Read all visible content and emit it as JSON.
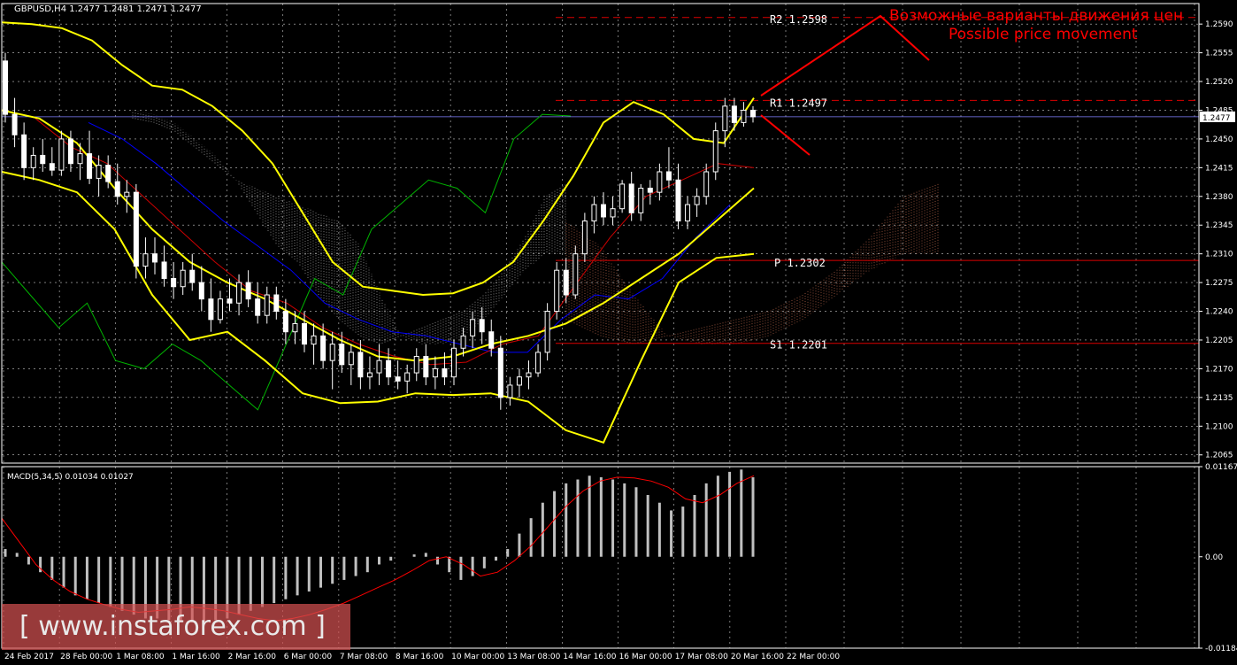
{
  "colors": {
    "background": "#000000",
    "grid": "#c8c8c8",
    "axis": "#ffffff",
    "text": "#ffffff",
    "bollinger": "#ffff00",
    "tenkan": "#cc0000",
    "kijun": "#0000ff",
    "chikou": "#00b400",
    "cloud_a": "#b4b4b4",
    "cloud_b": "#c86e50",
    "pivot_red": "#dc0000",
    "annotation_red": "#ff0000",
    "macd_hist": "#c0c0c0",
    "macd_signal": "#ff0000"
  },
  "header": {
    "symbol_line": "GBPUSD,H4  1.2477 1.2481 1.2471 1.2477"
  },
  "annotations": {
    "ru": "Возможные варианты движения цен",
    "en": "Possible price movement"
  },
  "watermark": "[ www.instaforex.com ]",
  "macd_header": "MACD(5,34,5) 0.01034 0.01027",
  "chart_data": [
    {
      "type": "candlestick",
      "title": "GBPUSD,H4",
      "ylim": [
        1.2055,
        1.2615
      ],
      "y_ticks": [
        "1.2590",
        "1.2555",
        "1.2520",
        "1.2485",
        "1.2450",
        "1.2415",
        "1.2380",
        "1.2345",
        "1.2310",
        "1.2275",
        "1.2240",
        "1.2205",
        "1.2170",
        "1.2135",
        "1.2100",
        "1.2065"
      ],
      "current_price_label": "1.2477",
      "current_price": 1.2477,
      "x_tick_labels": [
        "24 Feb 2017",
        "28 Feb 00:00",
        "1 Mar 08:00",
        "1 Mar 16:00",
        "2 Mar 16:00",
        "6 Mar 00:00",
        "7 Mar 08:00",
        "8 Mar 16:00",
        "10 Mar 00:00",
        "13 Mar 08:00",
        "14 Mar 16:00",
        "16 Mar 00:00",
        "17 Mar 08:00",
        "20 Mar 16:00",
        "22 Mar 00:00"
      ],
      "levels": [
        {
          "name": "R2",
          "label": "R2  1.2598",
          "value": 1.2598
        },
        {
          "name": "R1",
          "label": "R1  1.2497",
          "value": 1.2497
        },
        {
          "name": "P",
          "label": "P  1.2302",
          "value": 1.2302
        },
        {
          "name": "S1",
          "label": "S1  1.2201",
          "value": 1.2201
        }
      ],
      "candles": [
        [
          1.2545,
          1.2555,
          1.247,
          1.248
        ],
        [
          1.248,
          1.25,
          1.244,
          1.2455
        ],
        [
          1.2455,
          1.247,
          1.24,
          1.2415
        ],
        [
          1.2415,
          1.244,
          1.24,
          1.243
        ],
        [
          1.243,
          1.245,
          1.241,
          1.242
        ],
        [
          1.242,
          1.244,
          1.2405,
          1.2412
        ],
        [
          1.2412,
          1.246,
          1.2405,
          1.245
        ],
        [
          1.245,
          1.246,
          1.241,
          1.242
        ],
        [
          1.242,
          1.2445,
          1.24,
          1.2432
        ],
        [
          1.2432,
          1.246,
          1.2395,
          1.2402
        ],
        [
          1.2402,
          1.243,
          1.238,
          1.2418
        ],
        [
          1.2418,
          1.243,
          1.239,
          1.2398
        ],
        [
          1.2398,
          1.242,
          1.237,
          1.238
        ],
        [
          1.238,
          1.24,
          1.236,
          1.2385
        ],
        [
          1.2385,
          1.2395,
          1.228,
          1.2295
        ],
        [
          1.2295,
          1.233,
          1.228,
          1.231
        ],
        [
          1.231,
          1.233,
          1.2285,
          1.23
        ],
        [
          1.23,
          1.232,
          1.227,
          1.228
        ],
        [
          1.228,
          1.23,
          1.2255,
          1.227
        ],
        [
          1.227,
          1.23,
          1.226,
          1.229
        ],
        [
          1.229,
          1.231,
          1.2265,
          1.2275
        ],
        [
          1.2275,
          1.2295,
          1.224,
          1.2255
        ],
        [
          1.2255,
          1.228,
          1.2215,
          1.223
        ],
        [
          1.223,
          1.2265,
          1.2225,
          1.2255
        ],
        [
          1.2255,
          1.228,
          1.224,
          1.225
        ],
        [
          1.225,
          1.2285,
          1.2235,
          1.2275
        ],
        [
          1.2275,
          1.229,
          1.2245,
          1.2255
        ],
        [
          1.2255,
          1.2275,
          1.2225,
          1.2235
        ],
        [
          1.2235,
          1.227,
          1.2225,
          1.226
        ],
        [
          1.226,
          1.227,
          1.223,
          1.224
        ],
        [
          1.224,
          1.2255,
          1.22,
          1.2215
        ],
        [
          1.2215,
          1.224,
          1.22,
          1.2225
        ],
        [
          1.2225,
          1.224,
          1.219,
          1.22
        ],
        [
          1.22,
          1.2225,
          1.2175,
          1.221
        ],
        [
          1.221,
          1.2225,
          1.217,
          1.218
        ],
        [
          1.218,
          1.2215,
          1.2145,
          1.22
        ],
        [
          1.22,
          1.2215,
          1.2165,
          1.2175
        ],
        [
          1.2175,
          1.22,
          1.215,
          1.219
        ],
        [
          1.219,
          1.2205,
          1.2145,
          1.216
        ],
        [
          1.216,
          1.2185,
          1.2145,
          1.2165
        ],
        [
          1.2165,
          1.22,
          1.215,
          1.218
        ],
        [
          1.218,
          1.2195,
          1.215,
          1.216
        ],
        [
          1.216,
          1.218,
          1.2145,
          1.2155
        ],
        [
          1.2155,
          1.2175,
          1.214,
          1.2165
        ],
        [
          1.2165,
          1.2195,
          1.2155,
          1.2185
        ],
        [
          1.2185,
          1.22,
          1.215,
          1.216
        ],
        [
          1.216,
          1.2185,
          1.2145,
          1.217
        ],
        [
          1.217,
          1.219,
          1.215,
          1.216
        ],
        [
          1.216,
          1.2205,
          1.215,
          1.2195
        ],
        [
          1.2195,
          1.222,
          1.2185,
          1.221
        ],
        [
          1.221,
          1.224,
          1.2195,
          1.223
        ],
        [
          1.223,
          1.2245,
          1.22,
          1.2215
        ],
        [
          1.2215,
          1.223,
          1.2185,
          1.2195
        ],
        [
          1.2195,
          1.221,
          1.212,
          1.2135
        ],
        [
          1.2135,
          1.216,
          1.2125,
          1.215
        ],
        [
          1.215,
          1.217,
          1.2135,
          1.216
        ],
        [
          1.216,
          1.218,
          1.2145,
          1.2165
        ],
        [
          1.2165,
          1.22,
          1.216,
          1.219
        ],
        [
          1.219,
          1.225,
          1.218,
          1.224
        ],
        [
          1.224,
          1.23,
          1.223,
          1.229
        ],
        [
          1.229,
          1.2305,
          1.225,
          1.226
        ],
        [
          1.226,
          1.232,
          1.2255,
          1.231
        ],
        [
          1.231,
          1.236,
          1.23,
          1.235
        ],
        [
          1.235,
          1.238,
          1.2335,
          1.237
        ],
        [
          1.237,
          1.2385,
          1.2345,
          1.2355
        ],
        [
          1.2355,
          1.238,
          1.2345,
          1.2365
        ],
        [
          1.2365,
          1.24,
          1.236,
          1.2395
        ],
        [
          1.2395,
          1.241,
          1.235,
          1.236
        ],
        [
          1.236,
          1.2395,
          1.235,
          1.239
        ],
        [
          1.239,
          1.24,
          1.237,
          1.2385
        ],
        [
          1.2385,
          1.242,
          1.2375,
          1.241
        ],
        [
          1.241,
          1.244,
          1.239,
          1.24
        ],
        [
          1.24,
          1.242,
          1.234,
          1.235
        ],
        [
          1.235,
          1.238,
          1.234,
          1.237
        ],
        [
          1.237,
          1.239,
          1.2355,
          1.238
        ],
        [
          1.238,
          1.242,
          1.237,
          1.241
        ],
        [
          1.241,
          1.247,
          1.24,
          1.246
        ],
        [
          1.246,
          1.25,
          1.244,
          1.249
        ],
        [
          1.249,
          1.25,
          1.246,
          1.247
        ],
        [
          1.247,
          1.2495,
          1.2465,
          1.2485
        ],
        [
          1.2485,
          1.249,
          1.247,
          1.2477
        ]
      ],
      "bollinger_upper": [
        1.2592,
        1.259,
        1.2585,
        1.257,
        1.254,
        1.2515,
        1.251,
        1.249,
        1.246,
        1.242,
        1.236,
        1.23,
        1.227,
        1.2265,
        1.226,
        1.2262,
        1.2275,
        1.23,
        1.235,
        1.2405,
        1.247,
        1.2495,
        1.248,
        1.245,
        1.2445,
        1.25
      ],
      "bollinger_middle": [
        1.2485,
        1.2475,
        1.2445,
        1.239,
        1.234,
        1.23,
        1.2275,
        1.2255,
        1.223,
        1.2205,
        1.2185,
        1.218,
        1.2185,
        1.22,
        1.221,
        1.2225,
        1.225,
        1.228,
        1.231,
        1.235,
        1.239
      ],
      "bollinger_lower": [
        1.241,
        1.24,
        1.2385,
        1.234,
        1.226,
        1.2205,
        1.2215,
        1.218,
        1.214,
        1.2128,
        1.213,
        1.214,
        1.2138,
        1.214,
        1.213,
        1.2095,
        1.208,
        1.218,
        1.2275,
        1.2305,
        1.231
      ],
      "tenkan_sen": [
        1.2475,
        1.244,
        1.242,
        1.238,
        1.234,
        1.23,
        1.2265,
        1.225,
        1.222,
        1.22,
        1.2185,
        1.2175,
        1.2178,
        1.22,
        1.221,
        1.227,
        1.233,
        1.238,
        1.24,
        1.242,
        1.2415
      ],
      "kijun_sen": [
        1.247,
        1.245,
        1.242,
        1.2385,
        1.235,
        1.232,
        1.229,
        1.225,
        1.223,
        1.2215,
        1.221,
        1.22,
        1.219,
        1.219,
        1.223,
        1.226,
        1.2255,
        1.228,
        1.233,
        1.237
      ],
      "chikou_span": [
        1.23,
        1.226,
        1.222,
        1.225,
        1.218,
        1.217,
        1.22,
        1.218,
        1.215,
        1.212,
        1.22,
        1.228,
        1.226,
        1.234,
        1.237,
        1.24,
        1.239,
        1.236,
        1.245,
        1.248,
        1.2478
      ],
      "cloud_span_a": [
        1.2475,
        1.247,
        1.246,
        1.244,
        1.242,
        1.24,
        1.236,
        1.232,
        1.23,
        1.226,
        1.223,
        1.221,
        1.22,
        1.221,
        1.222,
        1.223,
        1.224,
        1.226,
        1.229,
        1.233,
        1.238,
        1.2395
      ],
      "cloud_span_b": [
        1.2485,
        1.248,
        1.247,
        1.245,
        1.243,
        1.24,
        1.239,
        1.238,
        1.237,
        1.236,
        1.235,
        1.232,
        1.226,
        1.221,
        1.22,
        1.22,
        1.221,
        1.223,
        1.226,
        1.229,
        1.231,
        1.231
      ]
    },
    {
      "type": "bar",
      "title": "MACD(5,34,5)",
      "ylim": [
        -0.01184,
        0.01167
      ],
      "y_ticks": [
        "0.01167",
        "0.00",
        "-0.01184"
      ],
      "histogram": [
        0.001,
        0.0005,
        -0.001,
        -0.002,
        -0.003,
        -0.004,
        -0.005,
        -0.0055,
        -0.006,
        -0.0065,
        -0.007,
        -0.0075,
        -0.008,
        -0.008,
        -0.0082,
        -0.0085,
        -0.0085,
        -0.0084,
        -0.0082,
        -0.008,
        -0.0075,
        -0.007,
        -0.0065,
        -0.006,
        -0.0055,
        -0.005,
        -0.0045,
        -0.004,
        -0.0035,
        -0.003,
        -0.0025,
        -0.002,
        -0.001,
        -0.0005,
        0.0,
        0.0003,
        0.0005,
        -0.001,
        -0.002,
        -0.003,
        -0.0025,
        -0.0015,
        -0.0005,
        0.001,
        0.003,
        0.005,
        0.007,
        0.0085,
        0.0095,
        0.01,
        0.0105,
        0.0103,
        0.01,
        0.0095,
        0.009,
        0.008,
        0.007,
        0.006,
        0.0065,
        0.008,
        0.0095,
        0.0105,
        0.011,
        0.0113,
        0.0103
      ],
      "signal": [
        0.005,
        0.002,
        -0.001,
        -0.003,
        -0.0045,
        -0.0055,
        -0.0062,
        -0.0068,
        -0.0072,
        -0.007,
        -0.0068,
        -0.0065,
        -0.0067,
        -0.007,
        -0.0075,
        -0.008,
        -0.0083,
        -0.008,
        -0.0075,
        -0.0068,
        -0.006,
        -0.005,
        -0.004,
        -0.003,
        -0.0018,
        -0.0005,
        0.0,
        -0.001,
        -0.0025,
        -0.002,
        -0.0005,
        0.0015,
        0.004,
        0.0065,
        0.0085,
        0.0098,
        0.0103,
        0.0102,
        0.0098,
        0.009,
        0.0075,
        0.007,
        0.008,
        0.0095,
        0.0105
      ]
    }
  ]
}
